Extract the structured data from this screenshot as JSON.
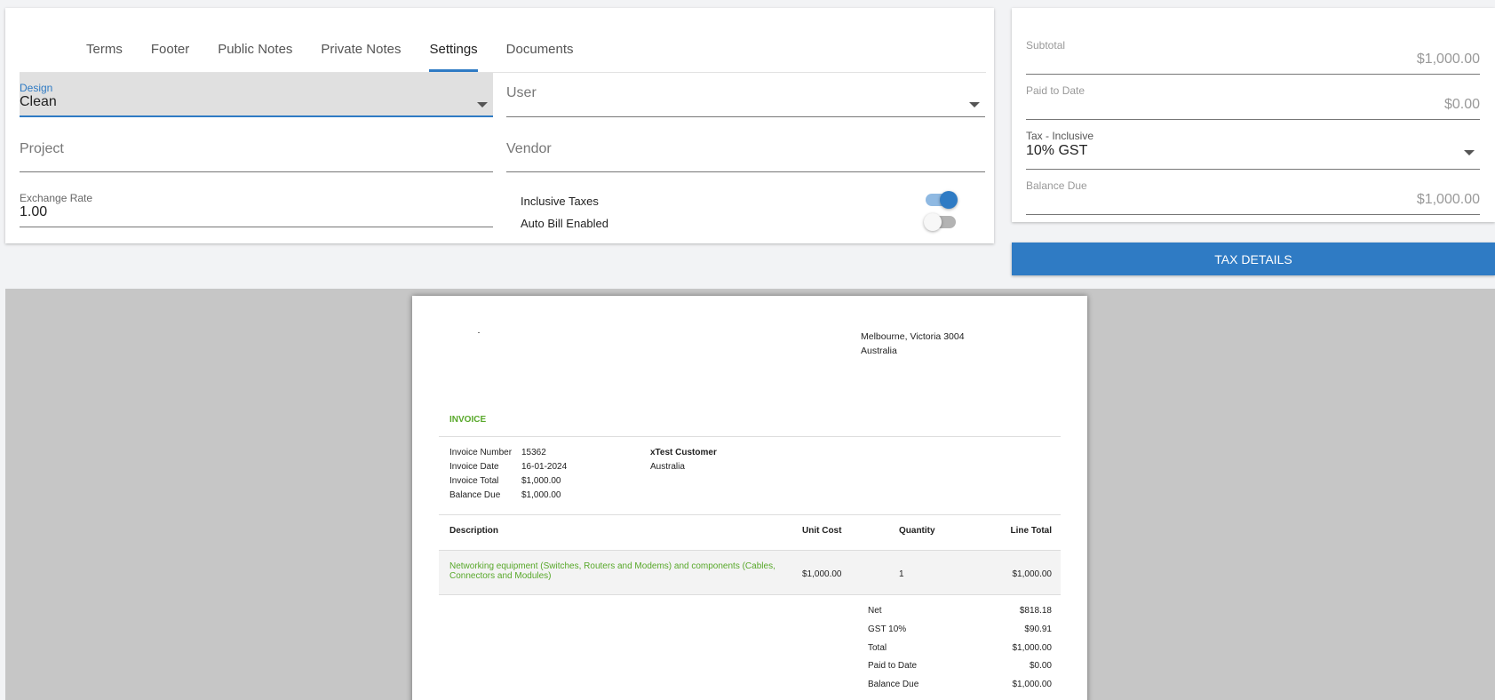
{
  "tabs": [
    {
      "label": "Terms"
    },
    {
      "label": "Footer"
    },
    {
      "label": "Public Notes"
    },
    {
      "label": "Private Notes"
    },
    {
      "label": "Settings",
      "active": true
    },
    {
      "label": "Documents"
    }
  ],
  "settings": {
    "design_label": "Design",
    "design_value": "Clean",
    "user_placeholder": "User",
    "project_placeholder": "Project",
    "vendor_placeholder": "Vendor",
    "exchange_rate_label": "Exchange Rate",
    "exchange_rate_value": "1.00",
    "inclusive_taxes_label": "Inclusive Taxes",
    "inclusive_taxes_on": true,
    "auto_bill_label": "Auto Bill Enabled",
    "auto_bill_on": false
  },
  "totals": {
    "subtotal_label": "Subtotal",
    "subtotal_value": "$1,000.00",
    "paid_label": "Paid to Date",
    "paid_value": "$0.00",
    "tax_label": "Tax - Inclusive",
    "tax_value": "10% GST",
    "balance_label": "Balance Due",
    "balance_value": "$1,000.00",
    "tax_details_button": "TAX DETAILS"
  },
  "invoice": {
    "address_line1": "Melbourne, Victoria 3004",
    "address_line2": "Australia",
    "heading": "INVOICE",
    "meta": [
      {
        "label": "Invoice Number",
        "value": "15362"
      },
      {
        "label": "Invoice Date",
        "value": "16-01-2024"
      },
      {
        "label": "Invoice Total",
        "value": "$1,000.00"
      },
      {
        "label": "Balance Due",
        "value": "$1,000.00"
      }
    ],
    "client_name": "xTest Customer",
    "client_country": "Australia",
    "columns": [
      "Description",
      "Unit Cost",
      "Quantity",
      "Line Total"
    ],
    "items": [
      {
        "description": "Networking equipment (Switches, Routers and Modems) and components (Cables, Connectors and Modules)",
        "unit_cost": "$1,000.00",
        "quantity": "1",
        "line_total": "$1,000.00"
      }
    ],
    "totals": [
      {
        "label": "Net",
        "value": "$818.18"
      },
      {
        "label": "GST 10%",
        "value": "$90.91"
      },
      {
        "label": "Total",
        "value": "$1,000.00"
      },
      {
        "label": "Paid to Date",
        "value": "$0.00"
      },
      {
        "label": "Balance Due",
        "value": "$1,000.00"
      }
    ]
  },
  "colors": {
    "accent": "#2f7bc4",
    "invoice_green": "#58a82a",
    "preview_background": "#c6c6c6"
  }
}
